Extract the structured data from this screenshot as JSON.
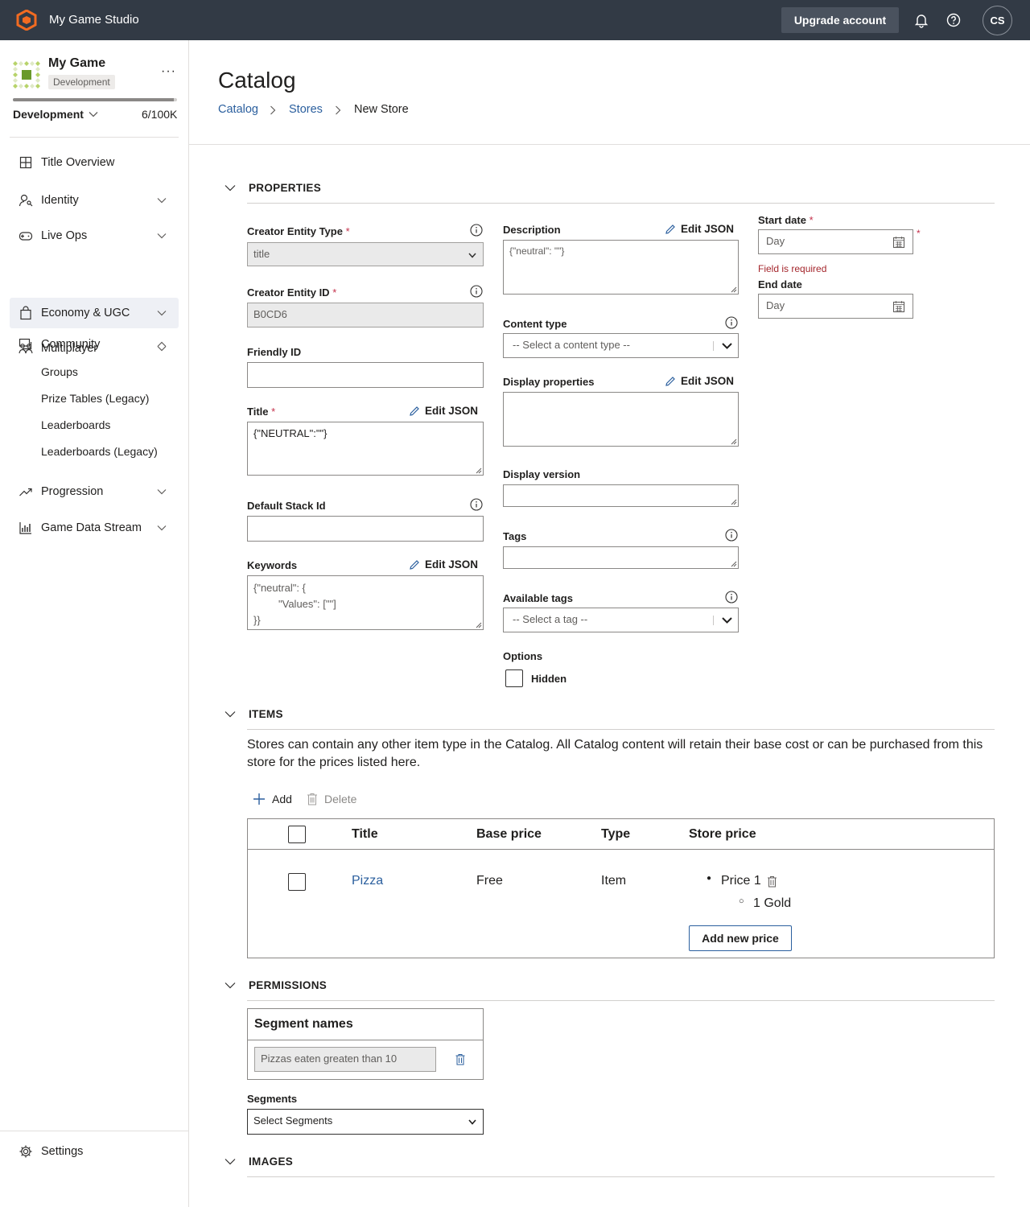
{
  "topbar": {
    "studio_name": "My Game Studio",
    "upgrade_label": "Upgrade account",
    "avatar_initials": "CS"
  },
  "sidebar": {
    "game_name": "My Game",
    "game_badge": "Development",
    "environment": "Development",
    "usage": "6/100K",
    "usage_fraction": 6e-05,
    "nav": [
      {
        "label": "Title Overview",
        "icon": "grid-icon"
      },
      {
        "label": "Identity",
        "icon": "user-key-icon"
      },
      {
        "label": "Live Ops",
        "icon": "gamepad-icon"
      },
      {
        "label": "Economy & UGC",
        "icon": "shopping-bag-icon"
      },
      {
        "label": "Multiplayer",
        "icon": "people-icon"
      },
      {
        "label": "Community",
        "icon": "chat-icon"
      },
      {
        "label": "Progression",
        "icon": "trend-icon"
      },
      {
        "label": "Game Data Stream",
        "icon": "bar-chart-icon"
      }
    ],
    "community_sub": [
      "Groups",
      "Prize Tables (Legacy)",
      "Leaderboards",
      "Leaderboards (Legacy)"
    ],
    "settings_label": "Settings"
  },
  "page": {
    "title": "Catalog",
    "breadcrumb": [
      "Catalog",
      "Stores",
      "New Store"
    ]
  },
  "properties": {
    "section_title": "PROPERTIES",
    "creator_entity_type_label": "Creator Entity Type",
    "creator_entity_type_value": "title",
    "creator_entity_id_label": "Creator Entity ID",
    "creator_entity_id_value": "B0CD6",
    "friendly_id_label": "Friendly ID",
    "title_label": "Title",
    "title_value": "{\"NEUTRAL\":\"\"}",
    "edit_json_label": "Edit JSON",
    "default_stack_label": "Default Stack Id",
    "keywords_label": "Keywords",
    "keywords_value_line1": "{\"neutral\": {",
    "keywords_value_line2": "\"Values\": [\"\"]",
    "keywords_value_line3": "}}",
    "description_label": "Description",
    "description_placeholder": "{\"neutral\": \"\"}",
    "content_type_label": "Content type",
    "content_type_placeholder": "-- Select a content type --",
    "display_properties_label": "Display properties",
    "display_version_label": "Display version",
    "tags_label": "Tags",
    "available_tags_label": "Available tags",
    "available_tags_placeholder": "-- Select a tag --",
    "options_label": "Options",
    "hidden_label": "Hidden",
    "start_date_label": "Start date",
    "end_date_label": "End date",
    "date_placeholder": "Day",
    "field_required": "Field is required",
    "required_mark": "*"
  },
  "items": {
    "section_title": "ITEMS",
    "description": "Stores can contain any other item type in the Catalog. All Catalog content will retain their base cost or can be purchased from this store for the prices listed here.",
    "add_label": "Add",
    "delete_label": "Delete",
    "columns": [
      "Title",
      "Base price",
      "Type",
      "Store price"
    ],
    "rows": [
      {
        "title": "Pizza",
        "base_price": "Free",
        "type": "Item",
        "price_name": "Price 1",
        "price_amount": "1 Gold"
      }
    ],
    "add_price_label": "Add new price"
  },
  "permissions": {
    "section_title": "PERMISSIONS",
    "segment_names_label": "Segment names",
    "segment_value": "Pizzas eaten greaten than 10",
    "segments_label": "Segments",
    "segments_select": "Select Segments"
  },
  "images": {
    "section_title": "IMAGES"
  }
}
